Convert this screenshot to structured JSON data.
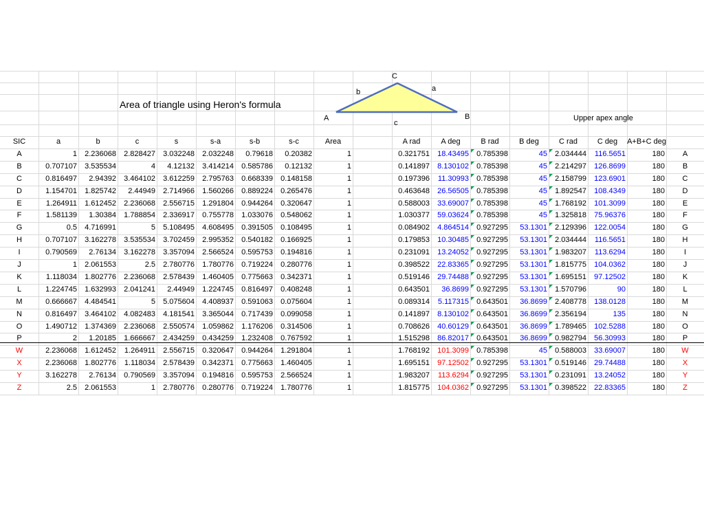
{
  "title": "Area of triangle using Heron's formula",
  "diagram": {
    "labels": {
      "a": "a",
      "b": "b",
      "c": "c",
      "A": "A",
      "B": "B",
      "C": "C"
    },
    "fill_color": "#ffff99",
    "stroke_color": "#4f6dbd"
  },
  "upper_apex_label": "Upper apex angle",
  "headers": [
    "SIC",
    "a",
    "b",
    "c",
    "s",
    "s-a",
    "s-b",
    "s-c",
    "Area",
    "",
    "A rad",
    "A deg",
    "B rad",
    "B deg",
    "C rad",
    "C deg",
    "A+B+C deg",
    ""
  ],
  "colors": {
    "blue_text": "#0000ff",
    "red_text": "#ff0000",
    "grid": "#d9d9d9",
    "marker": "#00a651"
  },
  "rows": [
    {
      "label": "A",
      "red": false,
      "a": "1",
      "b": "2.236068",
      "c": "2.828427",
      "s": "3.032248",
      "sa": "2.032248",
      "sb": "0.79618",
      "sc": "0.20382",
      "area": "1",
      "arad": "0.321751",
      "adeg": "18.43495",
      "brad": "0.785398",
      "bdeg": "45",
      "crad": "2.034444",
      "cdeg": "116.5651",
      "sum": "180"
    },
    {
      "label": "B",
      "red": false,
      "a": "0.707107",
      "b": "3.535534",
      "c": "4",
      "s": "4.12132",
      "sa": "3.414214",
      "sb": "0.585786",
      "sc": "0.12132",
      "area": "1",
      "arad": "0.141897",
      "adeg": "8.130102",
      "brad": "0.785398",
      "bdeg": "45",
      "crad": "2.214297",
      "cdeg": "126.8699",
      "sum": "180"
    },
    {
      "label": "C",
      "red": false,
      "a": "0.816497",
      "b": "2.94392",
      "c": "3.464102",
      "s": "3.612259",
      "sa": "2.795763",
      "sb": "0.668339",
      "sc": "0.148158",
      "area": "1",
      "arad": "0.197396",
      "adeg": "11.30993",
      "brad": "0.785398",
      "bdeg": "45",
      "crad": "2.158799",
      "cdeg": "123.6901",
      "sum": "180"
    },
    {
      "label": "D",
      "red": false,
      "a": "1.154701",
      "b": "1.825742",
      "c": "2.44949",
      "s": "2.714966",
      "sa": "1.560266",
      "sb": "0.889224",
      "sc": "0.265476",
      "area": "1",
      "arad": "0.463648",
      "adeg": "26.56505",
      "brad": "0.785398",
      "bdeg": "45",
      "crad": "1.892547",
      "cdeg": "108.4349",
      "sum": "180"
    },
    {
      "label": "E",
      "red": false,
      "a": "1.264911",
      "b": "1.612452",
      "c": "2.236068",
      "s": "2.556715",
      "sa": "1.291804",
      "sb": "0.944264",
      "sc": "0.320647",
      "area": "1",
      "arad": "0.588003",
      "adeg": "33.69007",
      "brad": "0.785398",
      "bdeg": "45",
      "crad": "1.768192",
      "cdeg": "101.3099",
      "sum": "180"
    },
    {
      "label": "F",
      "red": false,
      "a": "1.581139",
      "b": "1.30384",
      "c": "1.788854",
      "s": "2.336917",
      "sa": "0.755778",
      "sb": "1.033076",
      "sc": "0.548062",
      "area": "1",
      "arad": "1.030377",
      "adeg": "59.03624",
      "brad": "0.785398",
      "bdeg": "45",
      "crad": "1.325818",
      "cdeg": "75.96376",
      "sum": "180"
    },
    {
      "label": "G",
      "red": false,
      "a": "0.5",
      "b": "4.716991",
      "c": "5",
      "s": "5.108495",
      "sa": "4.608495",
      "sb": "0.391505",
      "sc": "0.108495",
      "area": "1",
      "arad": "0.084902",
      "adeg": "4.864514",
      "brad": "0.927295",
      "bdeg": "53.1301",
      "crad": "2.129396",
      "cdeg": "122.0054",
      "sum": "180"
    },
    {
      "label": "H",
      "red": false,
      "a": "0.707107",
      "b": "3.162278",
      "c": "3.535534",
      "s": "3.702459",
      "sa": "2.995352",
      "sb": "0.540182",
      "sc": "0.166925",
      "area": "1",
      "arad": "0.179853",
      "adeg": "10.30485",
      "brad": "0.927295",
      "bdeg": "53.1301",
      "crad": "2.034444",
      "cdeg": "116.5651",
      "sum": "180"
    },
    {
      "label": "I",
      "red": false,
      "a": "0.790569",
      "b": "2.76134",
      "c": "3.162278",
      "s": "3.357094",
      "sa": "2.566524",
      "sb": "0.595753",
      "sc": "0.194816",
      "area": "1",
      "arad": "0.231091",
      "adeg": "13.24052",
      "brad": "0.927295",
      "bdeg": "53.1301",
      "crad": "1.983207",
      "cdeg": "113.6294",
      "sum": "180"
    },
    {
      "label": "J",
      "red": false,
      "a": "1",
      "b": "2.061553",
      "c": "2.5",
      "s": "2.780776",
      "sa": "1.780776",
      "sb": "0.719224",
      "sc": "0.280776",
      "area": "1",
      "arad": "0.398522",
      "adeg": "22.83365",
      "brad": "0.927295",
      "bdeg": "53.1301",
      "crad": "1.815775",
      "cdeg": "104.0362",
      "sum": "180"
    },
    {
      "label": "K",
      "red": false,
      "a": "1.118034",
      "b": "1.802776",
      "c": "2.236068",
      "s": "2.578439",
      "sa": "1.460405",
      "sb": "0.775663",
      "sc": "0.342371",
      "area": "1",
      "arad": "0.519146",
      "adeg": "29.74488",
      "brad": "0.927295",
      "bdeg": "53.1301",
      "crad": "1.695151",
      "cdeg": "97.12502",
      "sum": "180"
    },
    {
      "label": "L",
      "red": false,
      "a": "1.224745",
      "b": "1.632993",
      "c": "2.041241",
      "s": "2.44949",
      "sa": "1.224745",
      "sb": "0.816497",
      "sc": "0.408248",
      "area": "1",
      "arad": "0.643501",
      "adeg": "36.8699",
      "brad": "0.927295",
      "bdeg": "53.1301",
      "crad": "1.570796",
      "cdeg": "90",
      "sum": "180"
    },
    {
      "label": "M",
      "red": false,
      "a": "0.666667",
      "b": "4.484541",
      "c": "5",
      "s": "5.075604",
      "sa": "4.408937",
      "sb": "0.591063",
      "sc": "0.075604",
      "area": "1",
      "arad": "0.089314",
      "adeg": "5.117315",
      "brad": "0.643501",
      "bdeg": "36.8699",
      "crad": "2.408778",
      "cdeg": "138.0128",
      "sum": "180"
    },
    {
      "label": "N",
      "red": false,
      "a": "0.816497",
      "b": "3.464102",
      "c": "4.082483",
      "s": "4.181541",
      "sa": "3.365044",
      "sb": "0.717439",
      "sc": "0.099058",
      "area": "1",
      "arad": "0.141897",
      "adeg": "8.130102",
      "brad": "0.643501",
      "bdeg": "36.8699",
      "crad": "2.356194",
      "cdeg": "135",
      "sum": "180"
    },
    {
      "label": "O",
      "red": false,
      "a": "1.490712",
      "b": "1.374369",
      "c": "2.236068",
      "s": "2.550574",
      "sa": "1.059862",
      "sb": "1.176206",
      "sc": "0.314506",
      "area": "1",
      "arad": "0.708626",
      "adeg": "40.60129",
      "brad": "0.643501",
      "bdeg": "36.8699",
      "crad": "1.789465",
      "cdeg": "102.5288",
      "sum": "180"
    },
    {
      "label": "P",
      "red": false,
      "a": "2",
      "b": "1.20185",
      "c": "1.666667",
      "s": "2.434259",
      "sa": "0.434259",
      "sb": "1.232408",
      "sc": "0.767592",
      "area": "1",
      "arad": "1.515298",
      "adeg": "86.82017",
      "brad": "0.643501",
      "bdeg": "36.8699",
      "crad": "0.982794",
      "cdeg": "56.30993",
      "sum": "180"
    },
    {
      "label": "W",
      "red": true,
      "a": "2.236068",
      "b": "1.612452",
      "c": "1.264911",
      "s": "2.556715",
      "sa": "0.320647",
      "sb": "0.944264",
      "sc": "1.291804",
      "area": "1",
      "arad": "1.768192",
      "adeg": "101.3099",
      "brad": "0.785398",
      "bdeg": "45",
      "crad": "0.588003",
      "cdeg": "33.69007",
      "sum": "180"
    },
    {
      "label": "X",
      "red": true,
      "a": "2.236068",
      "b": "1.802776",
      "c": "1.118034",
      "s": "2.578439",
      "sa": "0.342371",
      "sb": "0.775663",
      "sc": "1.460405",
      "area": "1",
      "arad": "1.695151",
      "adeg": "97.12502",
      "brad": "0.927295",
      "bdeg": "53.1301",
      "crad": "0.519146",
      "cdeg": "29.74488",
      "sum": "180"
    },
    {
      "label": "Y",
      "red": true,
      "a": "3.162278",
      "b": "2.76134",
      "c": "0.790569",
      "s": "3.357094",
      "sa": "0.194816",
      "sb": "0.595753",
      "sc": "2.566524",
      "area": "1",
      "arad": "1.983207",
      "adeg": "113.6294",
      "brad": "0.927295",
      "bdeg": "53.1301",
      "crad": "0.231091",
      "cdeg": "13.24052",
      "sum": "180"
    },
    {
      "label": "Z",
      "red": true,
      "a": "2.5",
      "b": "2.061553",
      "c": "1",
      "s": "2.780776",
      "sa": "0.280776",
      "sb": "0.719224",
      "sc": "1.780776",
      "area": "1",
      "arad": "1.815775",
      "adeg": "104.0362",
      "brad": "0.927295",
      "bdeg": "53.1301",
      "crad": "0.398522",
      "cdeg": "22.83365",
      "sum": "180"
    }
  ]
}
